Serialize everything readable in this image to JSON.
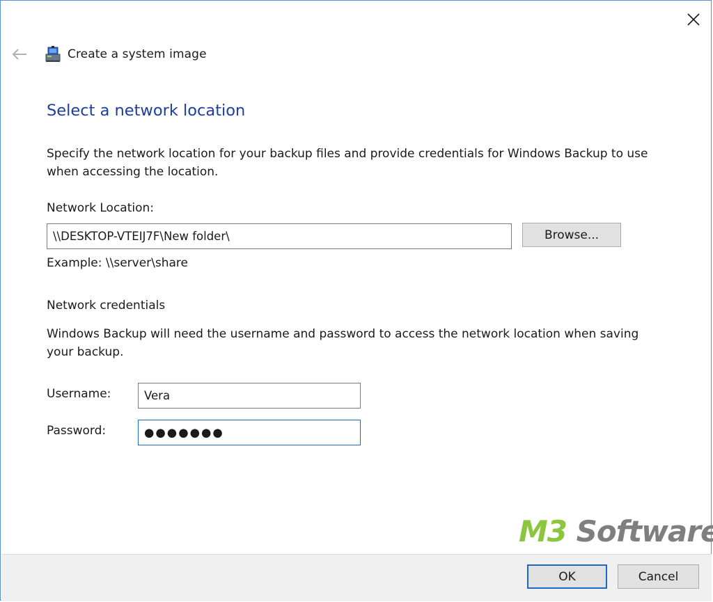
{
  "window": {
    "title": "Create a system image",
    "close_icon": "close-icon",
    "back_icon": "back-arrow-icon",
    "app_icon": "system-image-icon"
  },
  "page": {
    "heading": "Select a network location",
    "description": "Specify the network location for your backup files and provide credentials for Windows Backup to use when accessing the location."
  },
  "network_location": {
    "label": "Network Location:",
    "value": "\\\\DESKTOP-VTEIJ7F\\New folder\\",
    "browse_label": "Browse...",
    "example": "Example: \\\\server\\share"
  },
  "credentials": {
    "heading": "Network credentials",
    "description": "Windows Backup will need the username and password to access the network location when saving your backup.",
    "username_label": "Username:",
    "username_value": "Vera",
    "password_label": "Password:",
    "password_value": "●●●●●●●"
  },
  "footer": {
    "ok_label": "OK",
    "cancel_label": "Cancel"
  },
  "watermark": {
    "m3": "M3",
    "rest": " Software"
  },
  "colors": {
    "heading": "#1e3d9c",
    "focus_border": "#1c68c4",
    "window_border": "#5a8fd0"
  }
}
